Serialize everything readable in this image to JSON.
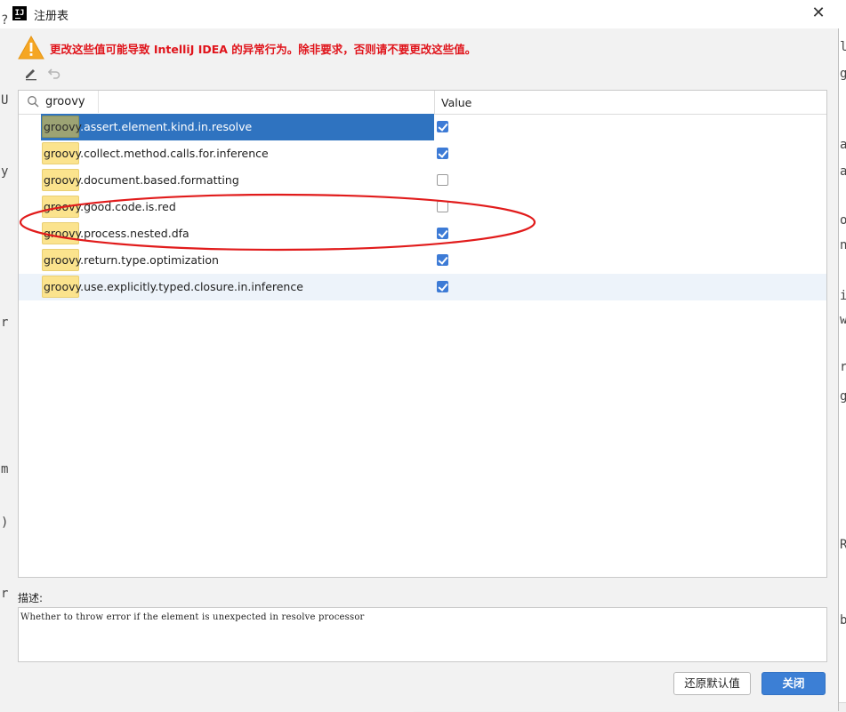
{
  "window": {
    "title": "注册表",
    "close_glyph": "✕"
  },
  "warning": {
    "text": "更改这些值可能导致 IntelliJ IDEA 的异常行为。除非要求，否则请不要更改这些值。",
    "color": "#e0141b"
  },
  "toolbar": {
    "edit_icon": "edit-icon",
    "revert_icon": "undo-icon"
  },
  "search": {
    "value": "groovy",
    "highlight_color": "#fbe38d"
  },
  "table": {
    "value_header": "Value",
    "rows": [
      {
        "prefix": "groovy",
        "suffix": ".assert.element.kind.in.resolve",
        "checked": true,
        "selected": true
      },
      {
        "prefix": "groovy",
        "suffix": ".collect.method.calls.for.inference",
        "checked": true
      },
      {
        "prefix": "groovy",
        "suffix": ".document.based.formatting",
        "checked": false
      },
      {
        "prefix": "groovy",
        "suffix": ".good.code.is.red",
        "checked": false
      },
      {
        "prefix": "groovy",
        "suffix": ".process.nested.dfa",
        "checked": true
      },
      {
        "prefix": "groovy",
        "suffix": ".return.type.optimization",
        "checked": true
      },
      {
        "prefix": "groovy",
        "suffix": ".use.explicitly.typed.closure.in.inference",
        "checked": true,
        "striped": true
      }
    ]
  },
  "annotation": {
    "ellipse_color": "#e11b1b"
  },
  "description": {
    "label": "描述:",
    "text": "Whether to throw error if the element is unexpected in resolve processor"
  },
  "buttons": {
    "reset_label": "还原默认值",
    "close_label": "关闭",
    "primary_color": "#3c7fd5"
  },
  "background_editor": {
    "fragments": [
      "?",
      "U",
      "y",
      "r",
      "m",
      ")",
      "r",
      "l",
      "g",
      "a",
      "a",
      "o",
      "n",
      "i",
      "w",
      "r",
      "g",
      "R",
      "b"
    ]
  }
}
